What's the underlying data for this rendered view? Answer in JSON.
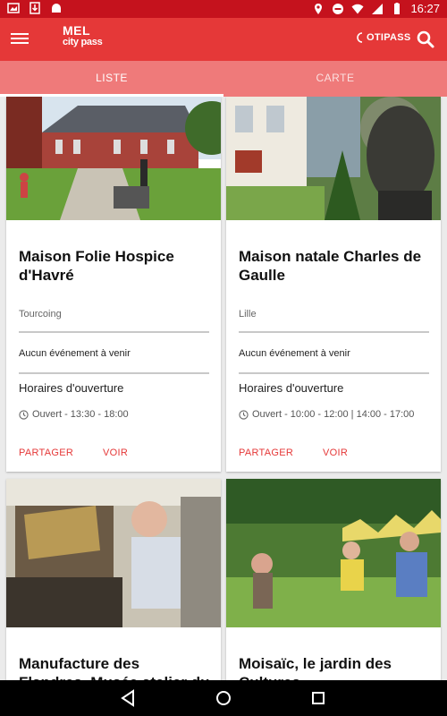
{
  "status_bar": {
    "time": "16:27"
  },
  "app": {
    "logo_line1": "MEL",
    "logo_line2": "city pass",
    "partner_logo": "OTIPASS"
  },
  "tabs": [
    {
      "label": "LISTE",
      "active": true
    },
    {
      "label": "CARTE",
      "active": false
    }
  ],
  "cards": [
    {
      "title": "Maison Folie Hospice d'Havré",
      "city": "Tourcoing",
      "events": "Aucun événement à venir",
      "hours_title": "Horaires d'ouverture",
      "hours": "Ouvert - 13:30 - 18:00",
      "share": "PARTAGER",
      "view": "VOIR"
    },
    {
      "title": "Maison natale Charles de Gaulle",
      "city": "Lille",
      "events": "Aucun événement à venir",
      "hours_title": "Horaires d'ouverture",
      "hours": "Ouvert - 10:00 - 12:00 | 14:00 - 17:00",
      "share": "PARTAGER",
      "view": "VOIR"
    },
    {
      "title": "Manufacture des Flandres, Musée atelier du textile"
    },
    {
      "title": "Moisaïc, le jardin des Cultures"
    }
  ],
  "colors": {
    "primary": "#e53838",
    "status_bar": "#c5121d",
    "tab_bar": "#ef7a7a"
  }
}
